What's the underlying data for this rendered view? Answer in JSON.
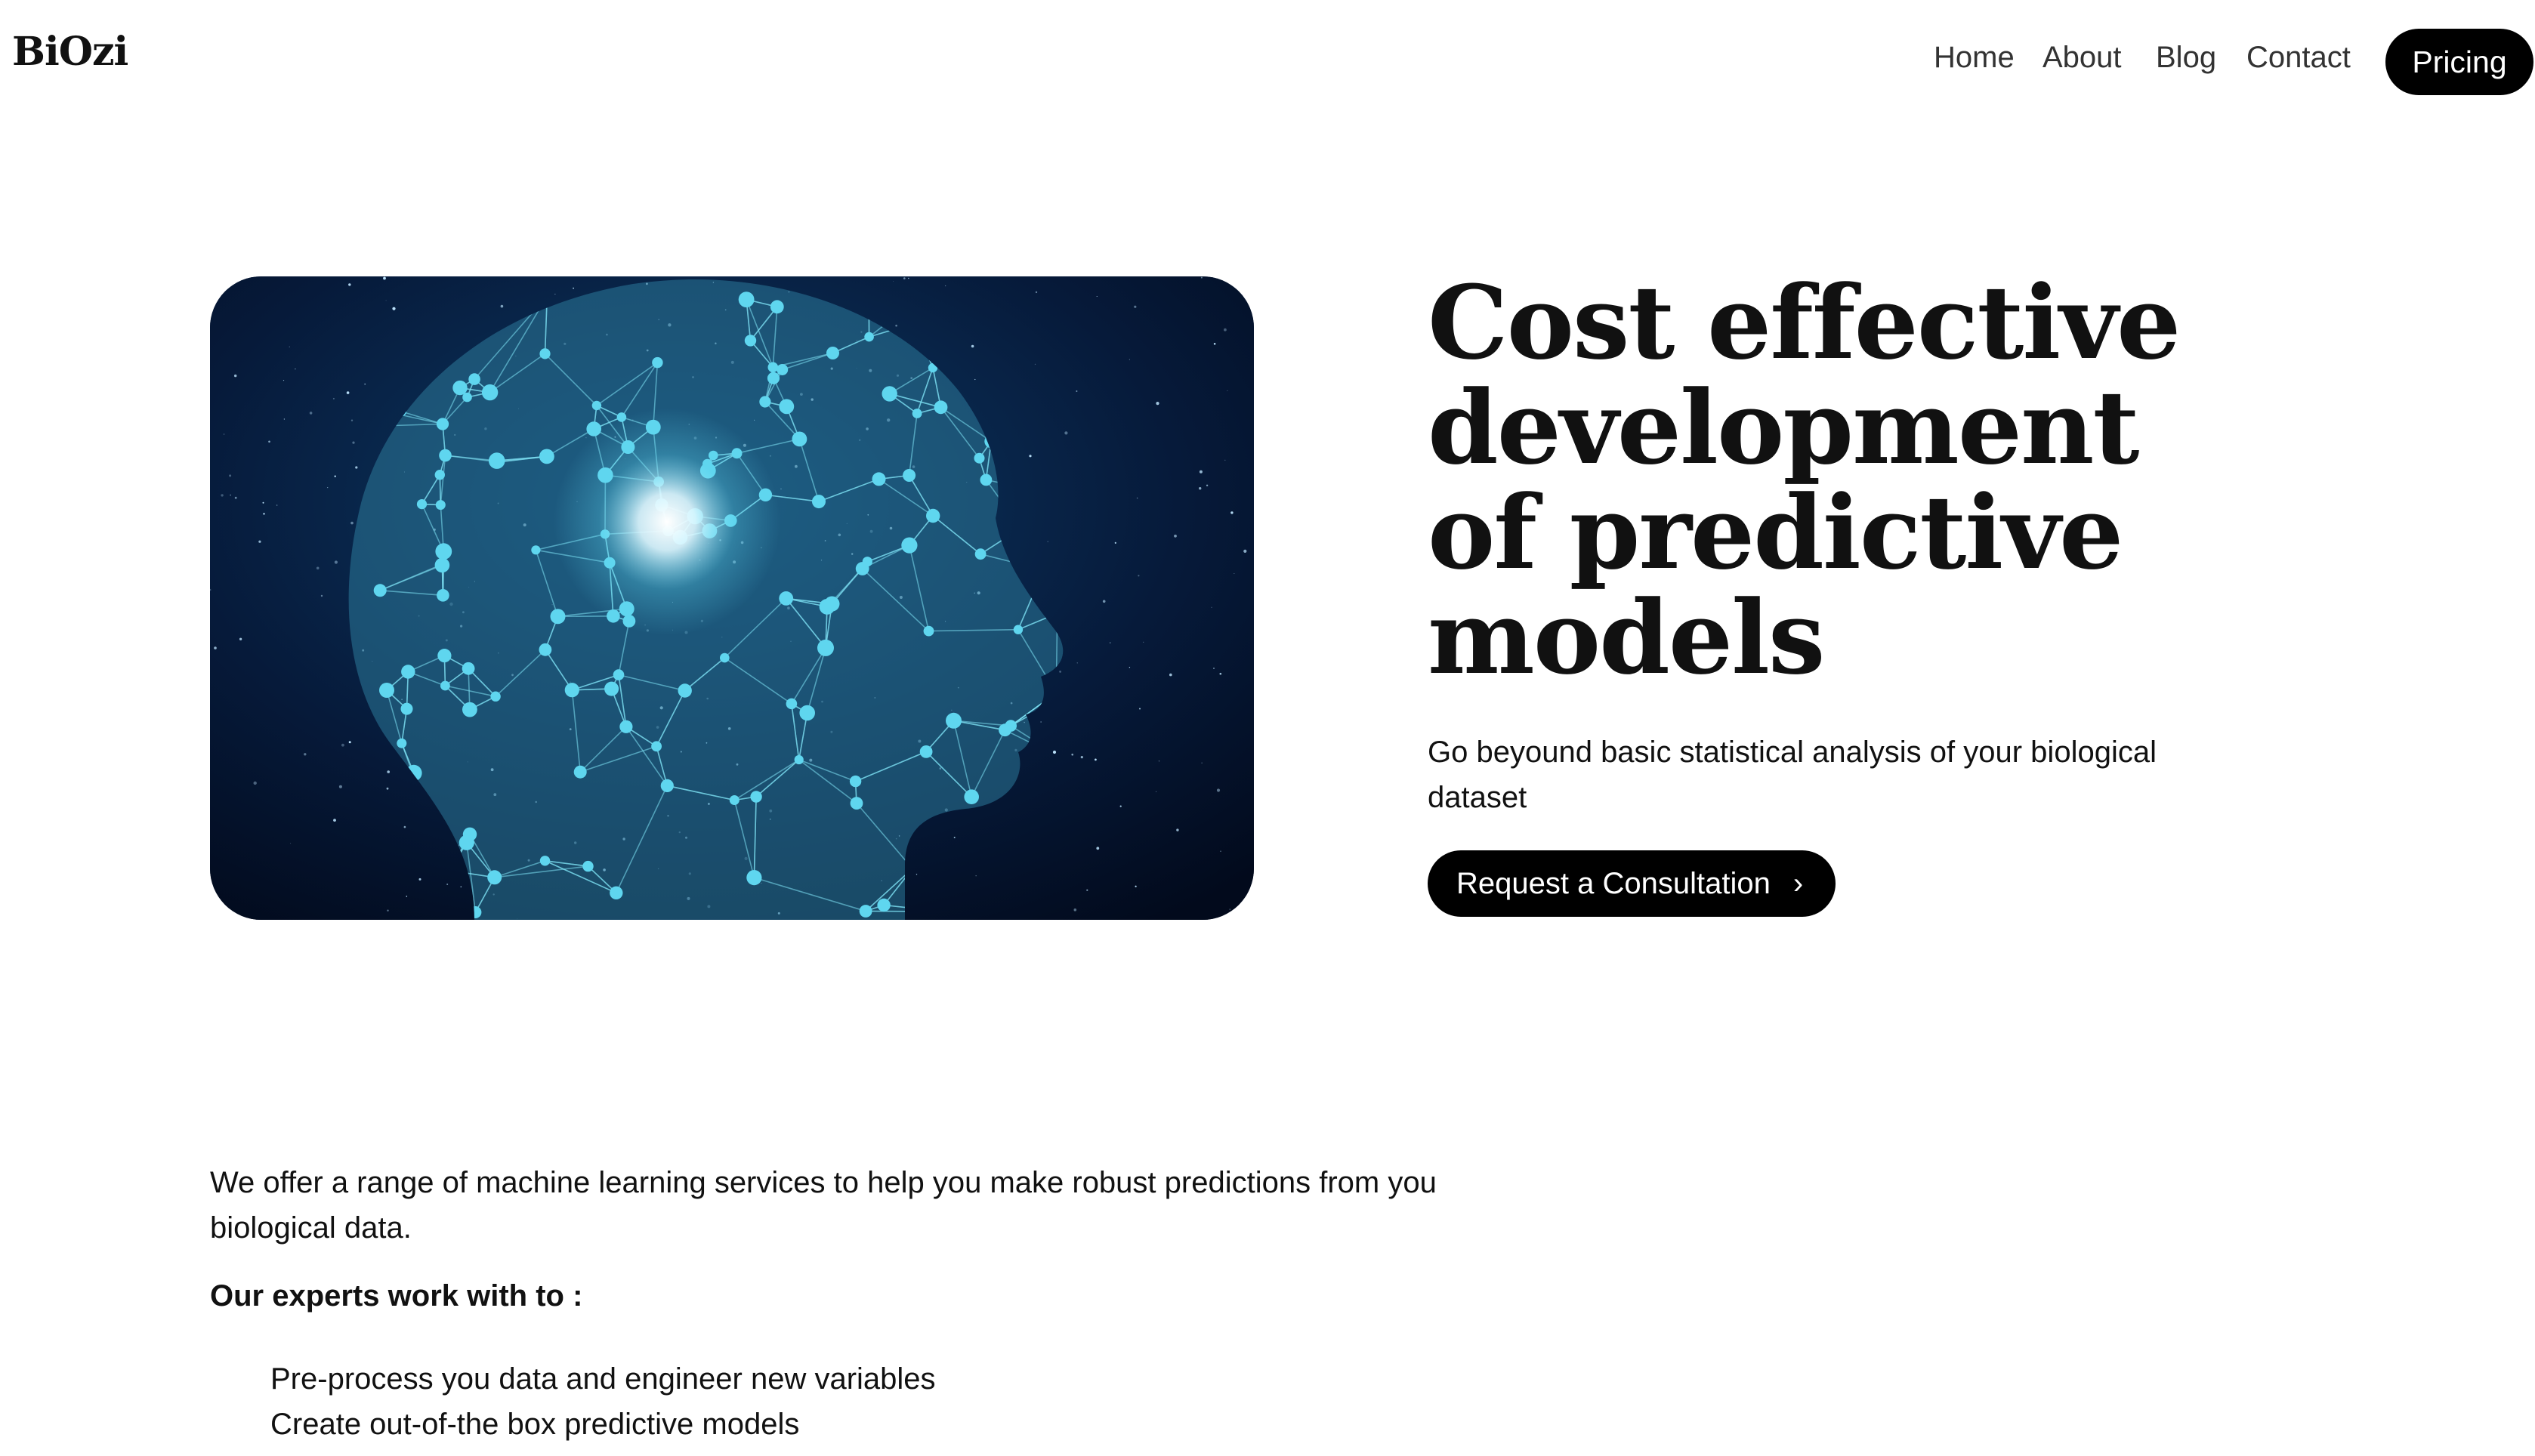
{
  "header": {
    "logo": "BiOzi",
    "nav": [
      "Home",
      "About",
      "Blog",
      "Contact"
    ],
    "pricing_label": "Pricing"
  },
  "hero": {
    "image_icon": "ai-head-network-illustration",
    "title": "Cost effective development of predictive models",
    "subtitle": "Go beyound basic statistical analysis of your biological dataset",
    "cta_label": "Request a Consultation",
    "cta_icon": "chevron-right-icon"
  },
  "content": {
    "intro": "We offer a range of machine learning services to help you make robust predictions from you biological data.",
    "experts_heading": "Our experts work with to :",
    "services": [
      "Pre-process you data and engineer new variables",
      "Create out-of-the box predictive models"
    ]
  },
  "colors": {
    "button_bg": "#000000",
    "button_text": "#ffffff",
    "text": "#111111",
    "image_bg": "#04122c",
    "image_accent": "#5fd6ef"
  }
}
